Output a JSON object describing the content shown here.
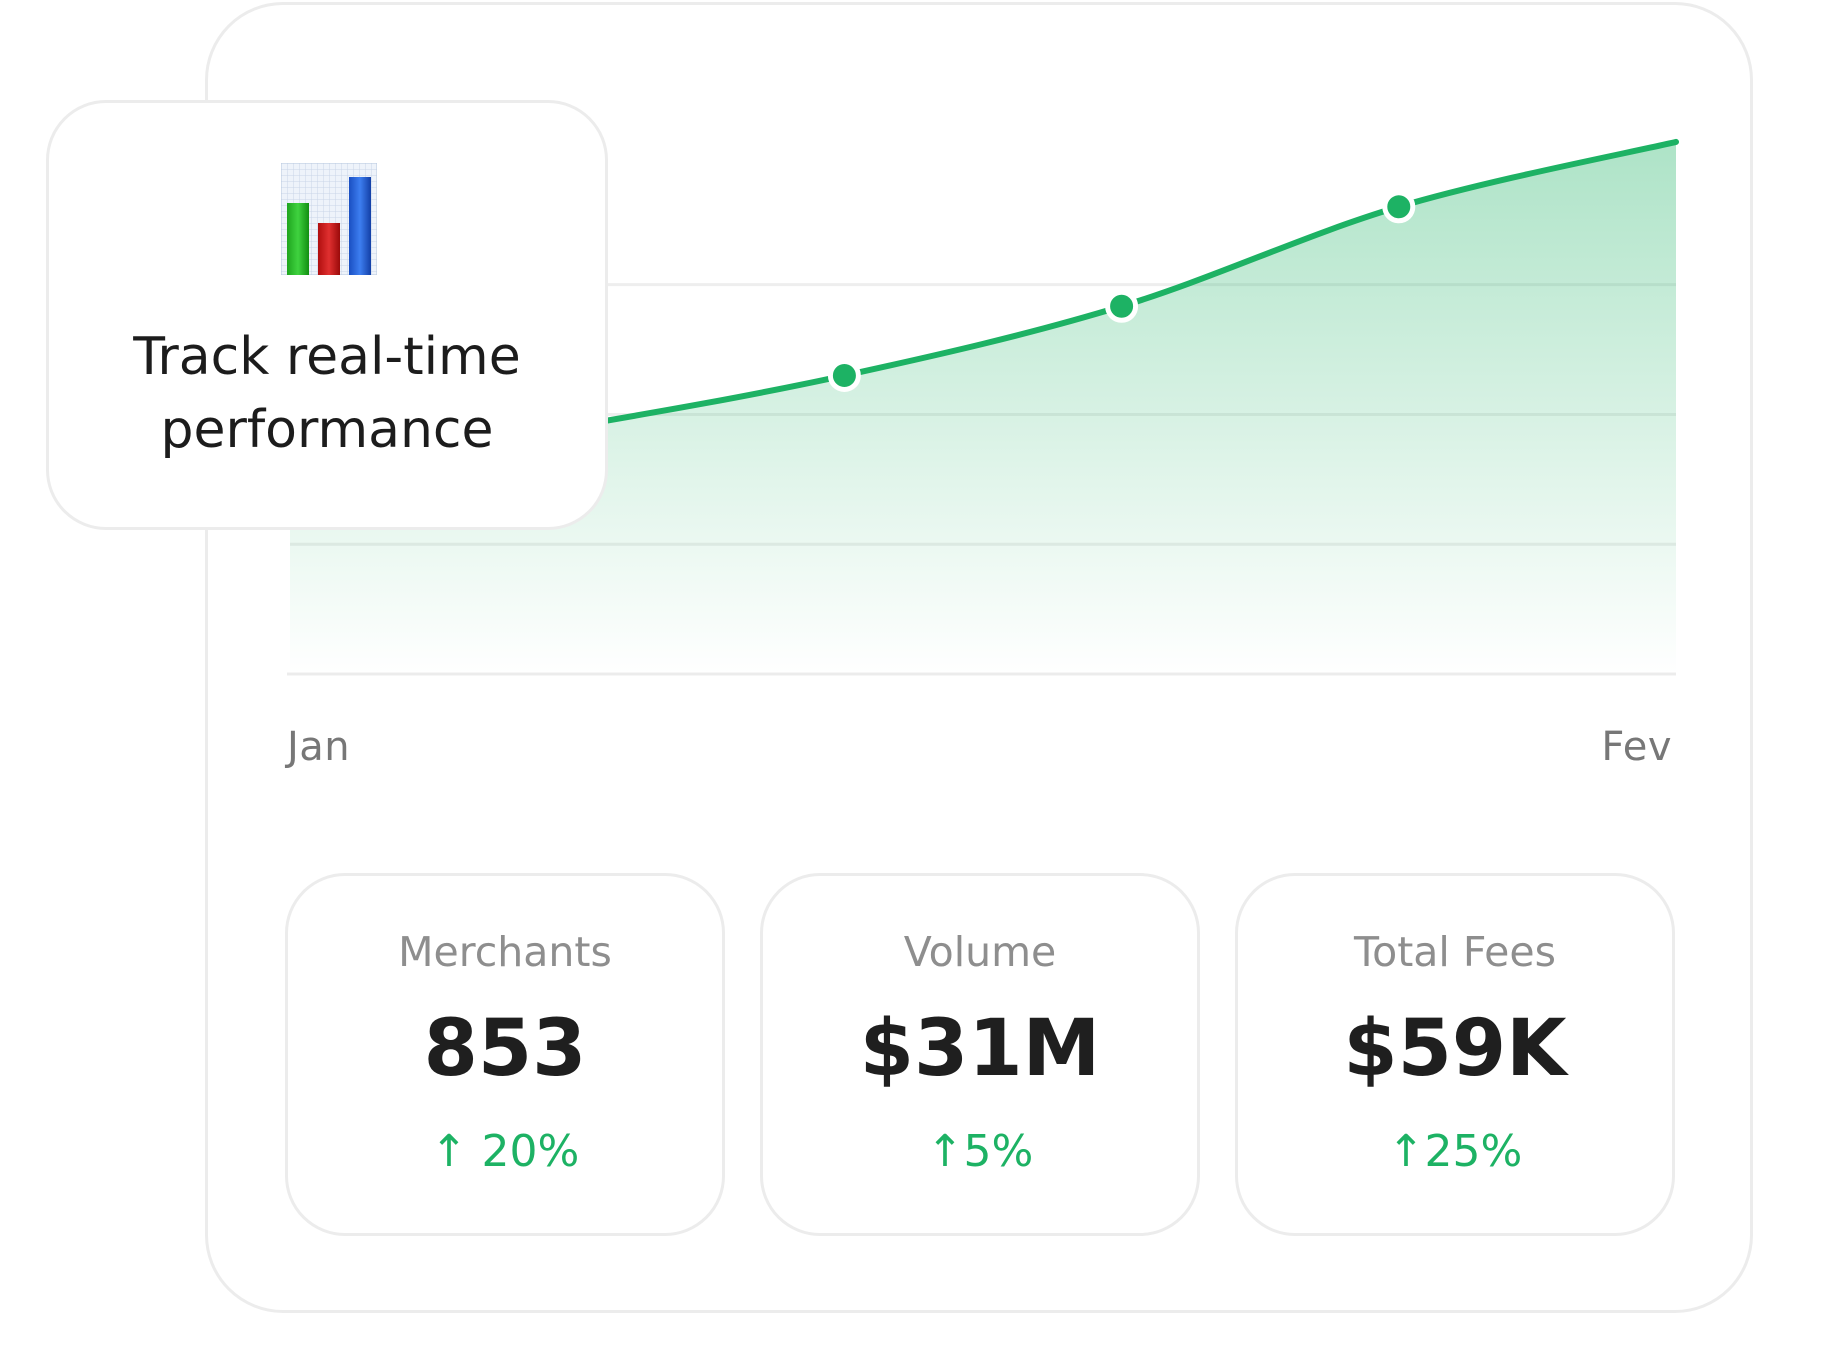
{
  "chart_data": {
    "type": "area",
    "x": [
      0,
      1,
      2,
      3,
      4,
      5
    ],
    "y": [
      47,
      57,
      69,
      85,
      108,
      123
    ],
    "ylim": [
      0,
      135
    ],
    "x_tick_labels": [
      "Jan",
      "Fev"
    ],
    "grid": true,
    "color": "#1db264"
  },
  "callout": {
    "title_line1": "Track real-time",
    "title_line2": "performance",
    "icon": "bar-chart-icon"
  },
  "axis": {
    "start_label": "Jan",
    "end_label": "Fev"
  },
  "stats": [
    {
      "label": "Merchants",
      "value": "853",
      "change": "↑ 20%"
    },
    {
      "label": "Volume",
      "value": "$31M",
      "change": "↑5%"
    },
    {
      "label": "Total Fees",
      "value": "$59K",
      "change": "↑25%"
    }
  ],
  "colors": {
    "accent": "#1db264",
    "border": "#ececec"
  }
}
